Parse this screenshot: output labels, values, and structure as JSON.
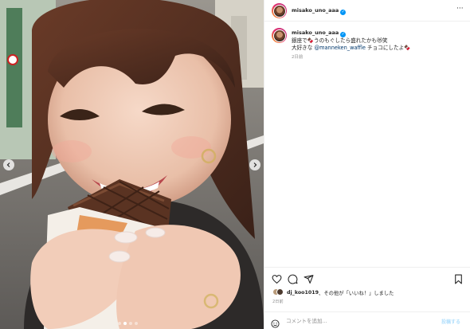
{
  "post": {
    "username": "misako_uno_aaa",
    "caption_line1": "銀座で🍫うのもぐしたら盛れたかも😻笑",
    "caption_line2_before": "大好きな ",
    "caption_mention": "@manneken_waffle",
    "caption_line2_after": " チョコにしたよ🍫",
    "caption_time": "2日前",
    "liked_by_user": "dj_koo1019",
    "liked_by_suffix": "、その他が「いいね！」しました",
    "post_date": "2日前",
    "comment_placeholder": "コメントを追加...",
    "post_button": "投稿する"
  },
  "carousel": {
    "total": 4,
    "active": 1
  },
  "icons": {
    "header_more": "more-icon",
    "like": "heart-icon",
    "comment": "comment-icon",
    "share": "share-icon",
    "save": "bookmark-icon",
    "emoji": "emoji-icon",
    "prev": "chevron-left-icon",
    "next": "chevron-right-icon"
  },
  "colors": {
    "verified": "#0095f6",
    "mention": "#00376b",
    "post_button_disabled": "#b2dffc"
  }
}
